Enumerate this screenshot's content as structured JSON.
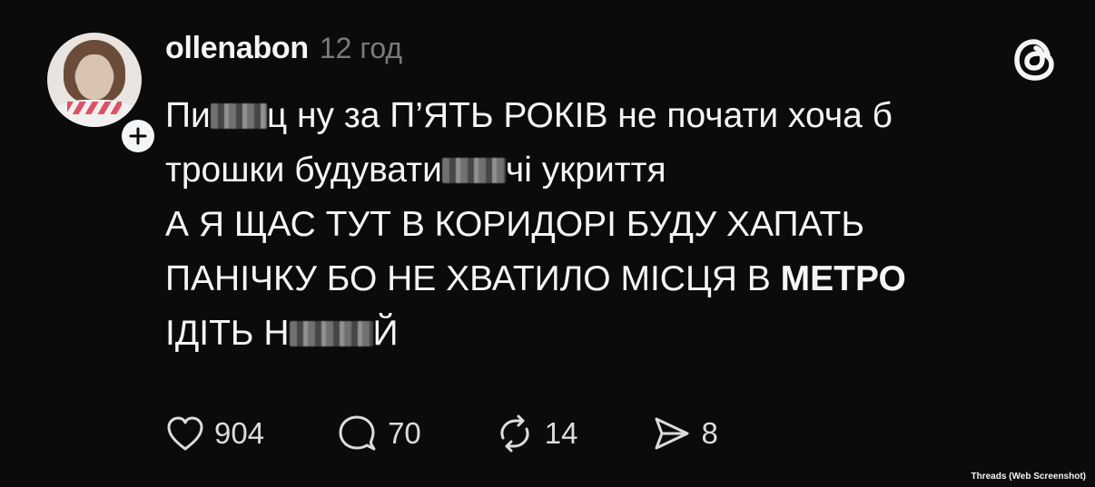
{
  "post": {
    "username": "ollenabon",
    "time": "12 год",
    "lines": [
      [
        "Пи",
        "ц ну за П’ЯТЬ РОКІВ не почати хоча б"
      ],
      [
        "трошки будувати",
        "чі укриття"
      ],
      [
        "А Я ЩАС ТУТ В КОРИДОРІ БУДУ ХАПАТЬ"
      ],
      [
        "ПАНІЧКУ БО НЕ ХВАТИЛО МІСЦЯ В ",
        "МЕТРО"
      ],
      [
        "ІДІТЬ Н",
        "Й"
      ]
    ]
  },
  "actions": {
    "likes": "904",
    "replies": "70",
    "reposts": "14",
    "shares": "8"
  },
  "credit": "Threads (Web Screenshot)",
  "icons": {
    "like": "heart-icon",
    "reply": "comment-icon",
    "repost": "repost-icon",
    "share": "send-icon",
    "follow": "plus-icon",
    "brand": "threads-logo-icon"
  },
  "colors": {
    "background": "#0b0b0b",
    "text": "#f3f5f7",
    "muted": "#7a7a7a"
  }
}
